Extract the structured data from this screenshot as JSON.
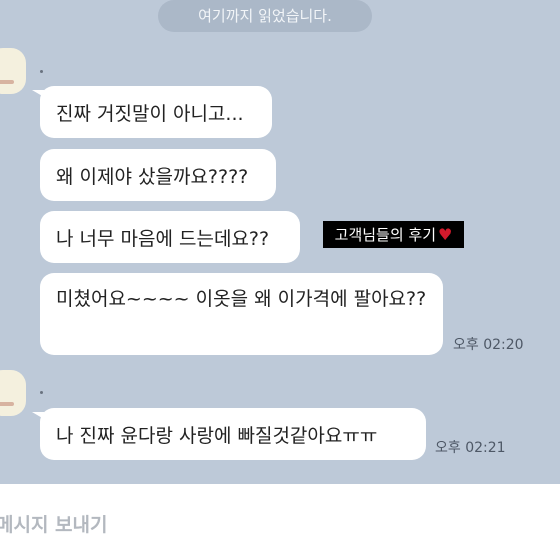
{
  "read_marker": "여기까지 읽었습니다.",
  "groups": [
    {
      "messages": [
        "진짜 거짓말이 아니고...",
        "왜 이제야 샀을까요????",
        "나 너무 마음에 드는데요??",
        "미쳤어요~~~~ 이옷을 왜 이가격에 팔아요??"
      ],
      "time": "오후 02:20"
    },
    {
      "messages": [
        "나 진짜 윤다랑 사랑에 빠질것같아요ㅠㅠ"
      ],
      "time": "오후 02:21"
    }
  ],
  "caption": {
    "text": "고객님들의 후기",
    "icon": "heart-icon",
    "icon_color": "#d31a2c"
  },
  "compose": {
    "placeholder": "메시지 보내기"
  },
  "colors": {
    "background": "#bdc9d8",
    "bubble": "#ffffff",
    "read_pill": "#abb8c8"
  }
}
